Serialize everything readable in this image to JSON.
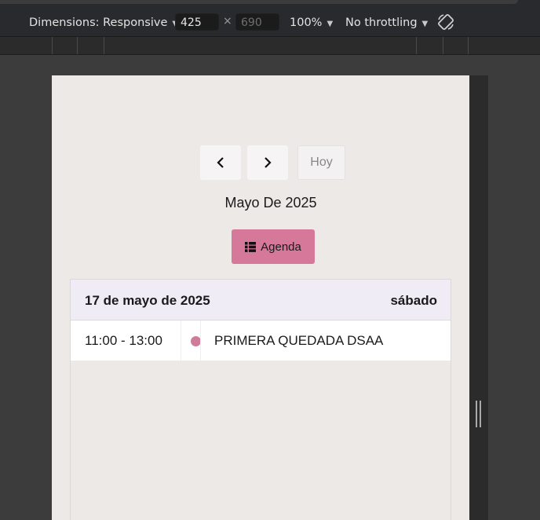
{
  "devtools": {
    "dimensions_label": "Dimensions: Responsive",
    "width_value": "425",
    "height_value": "690",
    "times_symbol": "×",
    "zoom_label": "100%",
    "throttle_label": "No throttling",
    "dropdown_caret": "▼"
  },
  "calendar": {
    "prev_icon": "chevron-left-icon",
    "next_icon": "chevron-right-icon",
    "today_label": "Hoy",
    "month_title": "Mayo De 2025",
    "view_button_label": "Agenda",
    "view_button_icon": "list-icon",
    "accent_color": "#d67899",
    "day": {
      "date_label": "17 de mayo de 2025",
      "weekday_label": "sábado",
      "events": [
        {
          "time": "11:00 - 13:00",
          "title": "PRIMERA QUEDADA DSAA",
          "dot_color": "#d07b99"
        }
      ]
    }
  }
}
